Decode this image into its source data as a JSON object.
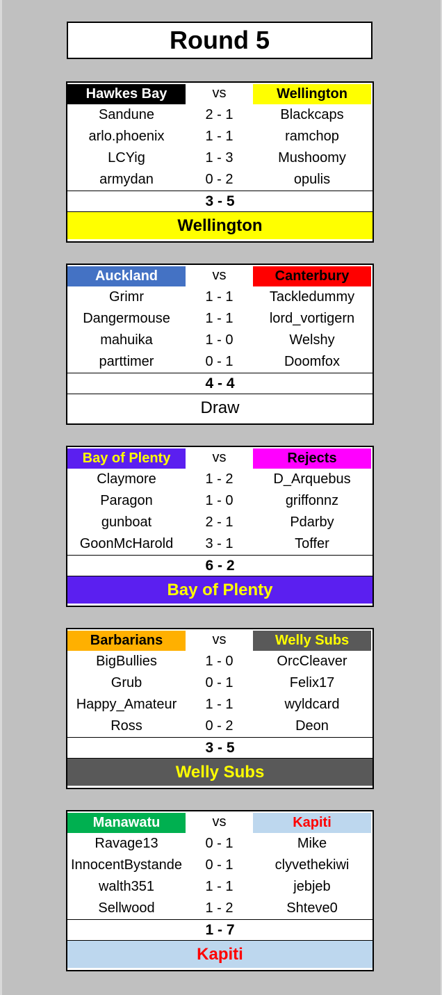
{
  "title": "Round 5",
  "vs_label": "vs",
  "matches": [
    {
      "home": {
        "name": "Hawkes Bay",
        "bg": "#000000",
        "fg": "#ffffff"
      },
      "away": {
        "name": "Wellington",
        "bg": "#ffff00",
        "fg": "#000000"
      },
      "games": [
        {
          "home": "Sandune",
          "score": "2 - 1",
          "away": "Blackcaps"
        },
        {
          "home": "arlo.phoenix",
          "score": "1 - 1",
          "away": "ramchop"
        },
        {
          "home": "LCYig",
          "score": "1 - 3",
          "away": "Mushoomy"
        },
        {
          "home": "armydan",
          "score": "0 - 2",
          "away": "opulis"
        }
      ],
      "total": "3 - 5",
      "result": {
        "text": "Wellington",
        "bg": "#ffff00",
        "fg": "#000000",
        "bold": true
      }
    },
    {
      "home": {
        "name": "Auckland",
        "bg": "#4472c4",
        "fg": "#ffffff"
      },
      "away": {
        "name": "Canterbury",
        "bg": "#ff0000",
        "fg": "#000000"
      },
      "games": [
        {
          "home": "Grimr",
          "score": "1 - 1",
          "away": "Tackledummy"
        },
        {
          "home": "Dangermouse",
          "score": "1 - 1",
          "away": "lord_vortigern"
        },
        {
          "home": "mahuika",
          "score": "1 - 0",
          "away": "Welshy"
        },
        {
          "home": "parttimer",
          "score": "0 - 1",
          "away": "Doomfox"
        }
      ],
      "total": "4 - 4",
      "result": {
        "text": "Draw",
        "bg": "#ffffff",
        "fg": "#000000",
        "bold": false
      }
    },
    {
      "home": {
        "name": "Bay of Plenty",
        "bg": "#5b1ff0",
        "fg": "#ffff00"
      },
      "away": {
        "name": "Rejects",
        "bg": "#ff00ff",
        "fg": "#000000"
      },
      "games": [
        {
          "home": "Claymore",
          "score": "1 - 2",
          "away": "D_Arquebus"
        },
        {
          "home": "Paragon",
          "score": "1 - 0",
          "away": "griffonnz"
        },
        {
          "home": "gunboat",
          "score": "2 - 1",
          "away": "Pdarby"
        },
        {
          "home": "GoonMcHarold",
          "score": "3 - 1",
          "away": "Toffer"
        }
      ],
      "total": "6 - 2",
      "result": {
        "text": "Bay of Plenty",
        "bg": "#5b1ff0",
        "fg": "#ffff00",
        "bold": true
      }
    },
    {
      "home": {
        "name": "Barbarians",
        "bg": "#ffb000",
        "fg": "#000000"
      },
      "away": {
        "name": "Welly Subs",
        "bg": "#595959",
        "fg": "#ffff00"
      },
      "games": [
        {
          "home": "BigBullies",
          "score": "1 - 0",
          "away": "OrcCleaver"
        },
        {
          "home": "Grub",
          "score": "0 - 1",
          "away": "Felix17"
        },
        {
          "home": "Happy_Amateur",
          "score": "1 - 1",
          "away": "wyldcard"
        },
        {
          "home": "Ross",
          "score": "0 - 2",
          "away": "Deon"
        }
      ],
      "total": "3 - 5",
      "result": {
        "text": "Welly Subs",
        "bg": "#595959",
        "fg": "#ffff00",
        "bold": true
      }
    },
    {
      "home": {
        "name": "Manawatu",
        "bg": "#00b050",
        "fg": "#ffffff"
      },
      "away": {
        "name": "Kapiti",
        "bg": "#bdd7ee",
        "fg": "#ff0000"
      },
      "games": [
        {
          "home": "Ravage13",
          "score": "0 - 1",
          "away": "Mike"
        },
        {
          "home": "InnocentBystande",
          "score": "0 - 1",
          "away": "clyvethekiwi"
        },
        {
          "home": "walth351",
          "score": "1 - 1",
          "away": "jebjeb"
        },
        {
          "home": "Sellwood",
          "score": "1 - 2",
          "away": "Shteve0"
        }
      ],
      "total": "1 - 7",
      "result": {
        "text": "Kapiti",
        "bg": "#bdd7ee",
        "fg": "#ff0000",
        "bold": true
      }
    }
  ]
}
